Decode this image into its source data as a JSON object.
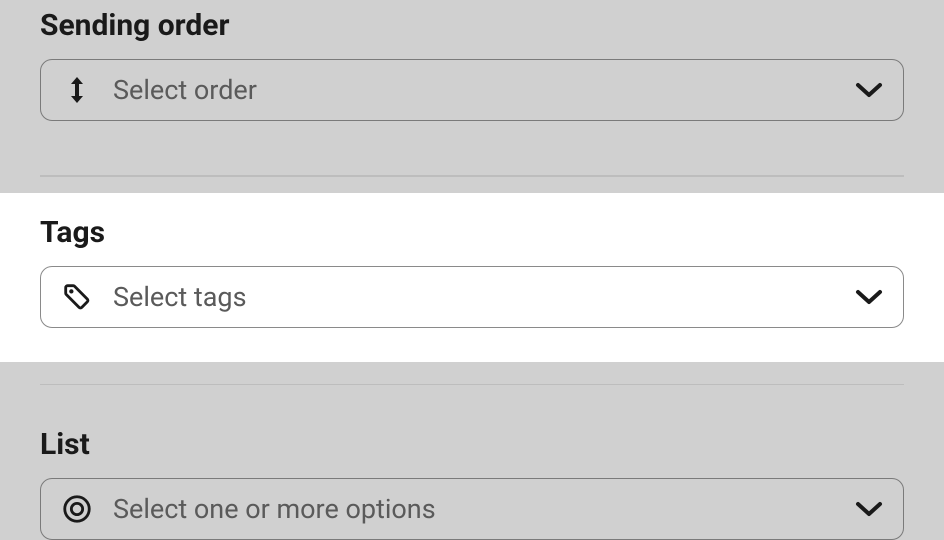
{
  "sendingOrder": {
    "label": "Sending order",
    "placeholder": "Select order"
  },
  "tags": {
    "label": "Tags",
    "placeholder": "Select tags"
  },
  "list": {
    "label": "List",
    "placeholder": "Select one or more options"
  }
}
